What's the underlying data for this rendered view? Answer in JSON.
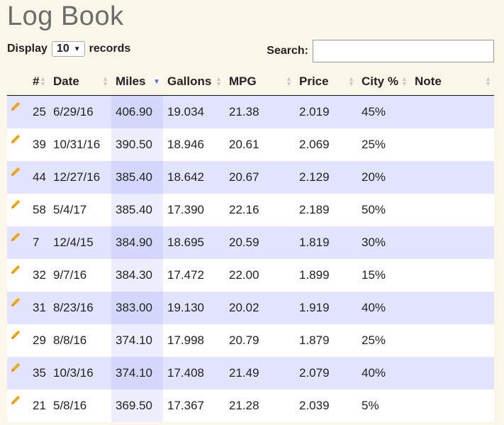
{
  "page_title": "Log Book",
  "length_control": {
    "prefix": "Display",
    "selected": "10",
    "suffix": "records"
  },
  "search": {
    "label": "Search:",
    "value": ""
  },
  "table": {
    "columns": [
      "",
      "#",
      "Date",
      "Miles",
      "Gallons",
      "MPG",
      "Price",
      "City %",
      "Note"
    ],
    "sorted_column": "Miles",
    "sort_direction": "descending",
    "rows": [
      {
        "num": "25",
        "date": "6/29/16",
        "miles": "406.90",
        "gallons": "19.034",
        "mpg": "21.38",
        "price": "2.019",
        "city": "45%",
        "note": ""
      },
      {
        "num": "39",
        "date": "10/31/16",
        "miles": "390.50",
        "gallons": "18.946",
        "mpg": "20.61",
        "price": "2.069",
        "city": "25%",
        "note": ""
      },
      {
        "num": "44",
        "date": "12/27/16",
        "miles": "385.40",
        "gallons": "18.642",
        "mpg": "20.67",
        "price": "2.129",
        "city": "20%",
        "note": ""
      },
      {
        "num": "58",
        "date": "5/4/17",
        "miles": "385.40",
        "gallons": "17.390",
        "mpg": "22.16",
        "price": "2.189",
        "city": "50%",
        "note": ""
      },
      {
        "num": "7",
        "date": "12/4/15",
        "miles": "384.90",
        "gallons": "18.695",
        "mpg": "20.59",
        "price": "1.819",
        "city": "30%",
        "note": ""
      },
      {
        "num": "32",
        "date": "9/7/16",
        "miles": "384.30",
        "gallons": "17.472",
        "mpg": "22.00",
        "price": "1.899",
        "city": "15%",
        "note": ""
      },
      {
        "num": "31",
        "date": "8/23/16",
        "miles": "383.00",
        "gallons": "19.130",
        "mpg": "20.02",
        "price": "1.919",
        "city": "40%",
        "note": ""
      },
      {
        "num": "29",
        "date": "8/8/16",
        "miles": "374.10",
        "gallons": "17.998",
        "mpg": "20.79",
        "price": "1.879",
        "city": "25%",
        "note": ""
      },
      {
        "num": "35",
        "date": "10/3/16",
        "miles": "374.10",
        "gallons": "17.408",
        "mpg": "21.49",
        "price": "2.079",
        "city": "40%",
        "note": ""
      },
      {
        "num": "21",
        "date": "5/8/16",
        "miles": "369.50",
        "gallons": "17.367",
        "mpg": "21.28",
        "price": "2.039",
        "city": "5%",
        "note": ""
      }
    ]
  },
  "colors": {
    "odd_row": "#e1e3ff",
    "sorted_cell": "#d4d7fb",
    "background": "#fbf7e8",
    "pencil": "#f0a500"
  },
  "icons": {
    "edit": "pencil-icon",
    "sort": "sort-arrows-icon"
  }
}
